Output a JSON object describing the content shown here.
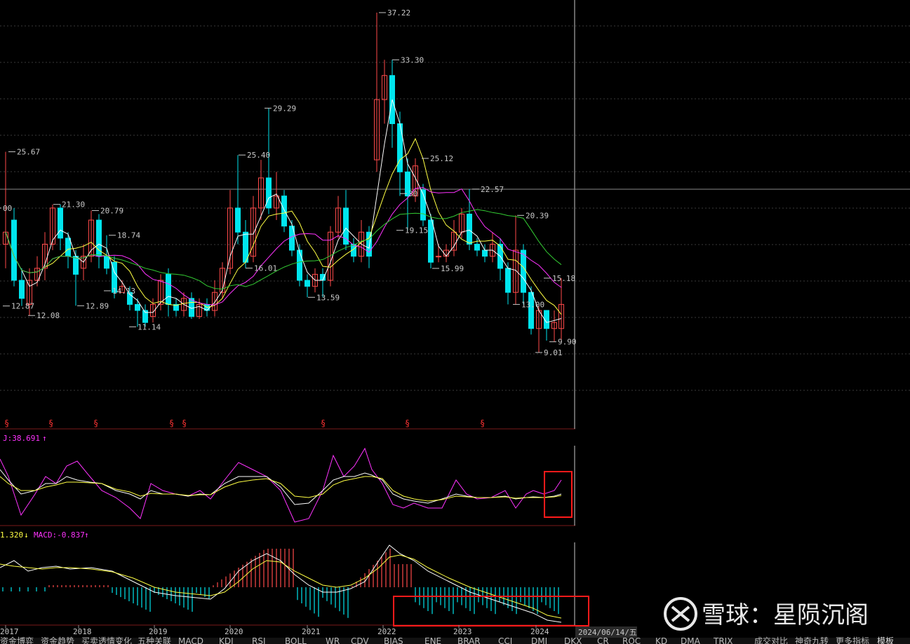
{
  "chart_data": {
    "type": "candlestick",
    "price_panel": {
      "annotations": {
        "high_2017": "25.67",
        "low_2017a": "12.87",
        "low_2017b": "12.08",
        "high_2017b": "21.30",
        "high_2018": "20.79",
        "low_2018": "12.89",
        "high_2018b": "18.74",
        "low_2018b": "14.13",
        "low_2019": "11.14",
        "high_2020": "25.40",
        "high_2020b": "29.29",
        "low_2020": "16.01",
        "low_2021": "13.59",
        "high_2022": "37.22",
        "high_2022b": "33.30",
        "high_2022c": "25.12",
        "low_2022": "19.15",
        "low_2023": "15.99",
        "high_2023": "22.57",
        "high_2023b": "20.39",
        "low_2024a": "13.00",
        "high_2024": "15.18",
        "low_2024b": "9.90",
        "low_2024c": "9.01",
        "left_cut": "00",
        "mid_cut": "30"
      },
      "signal_glyph": "§"
    },
    "kdj_panel": {
      "label": "J:38.691",
      "arrow": "↑"
    },
    "macd_panel": {
      "dea_label": "1.320",
      "dea_arrow": "↓",
      "macd_label": "MACD:-0.837",
      "macd_arrow": "↑"
    },
    "x_axis_years": [
      "2017",
      "2018",
      "2019",
      "2020",
      "2021",
      "2022",
      "2023",
      "2024"
    ],
    "date_readout": "2024/06/14/五"
  },
  "tabs": [
    "资金博弈",
    "资金趋势",
    "买卖透情变化",
    "五种关联",
    "MACD",
    "KDJ",
    "RSI",
    "BOLL",
    "WR",
    "CDV",
    "BIAS",
    "ENE",
    "BRAR",
    "CCI",
    "DMI",
    "DKX",
    "CR",
    "ROC",
    "KD",
    "DMA",
    "TRIX",
    "成交对比",
    "神奇九转",
    "更多指标"
  ],
  "tab_right": "模板",
  "watermark": {
    "text": "雪球：星陨沉阁"
  },
  "colors": {
    "up": "#ff4a4a",
    "down": "#00e5ee",
    "ma_white": "#ffffff",
    "ma_yellow": "#ffff44",
    "ma_magenta": "#ff33ff",
    "ma_green": "#33cc33",
    "highlight_box": "#ff1a1a"
  }
}
